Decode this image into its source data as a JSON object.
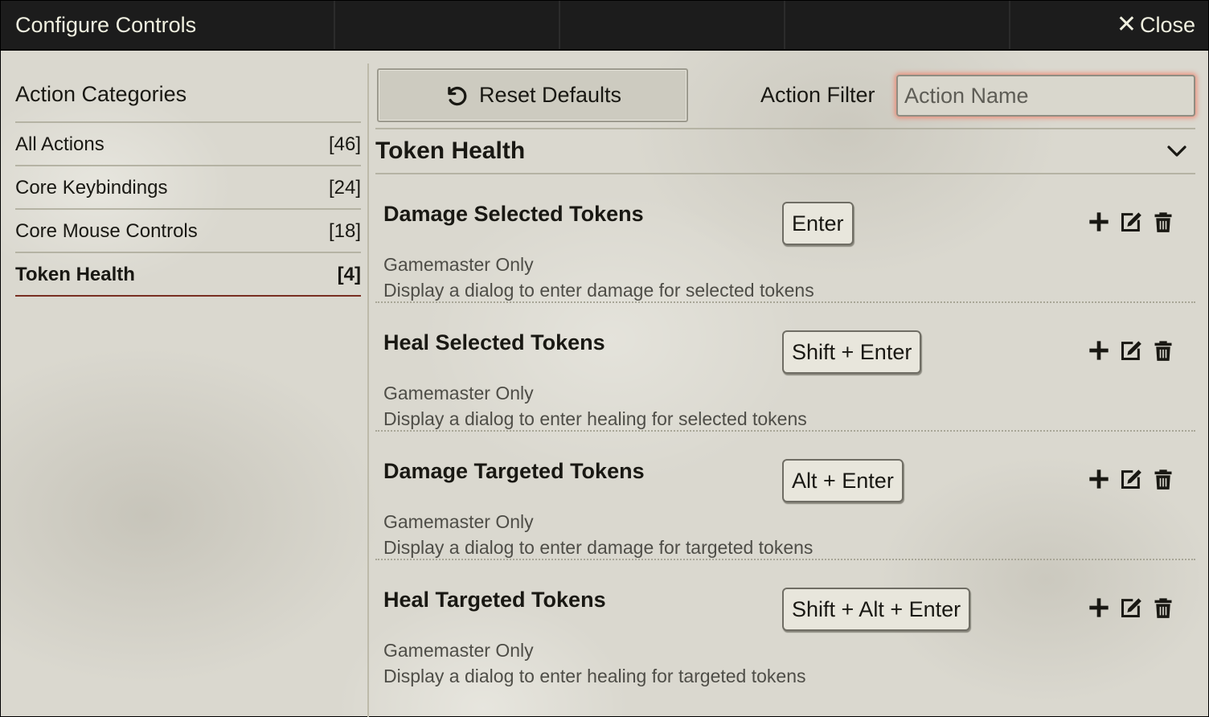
{
  "window": {
    "title": "Configure Controls",
    "close_label": "Close"
  },
  "sidebar": {
    "heading": "Action Categories",
    "categories": [
      {
        "label": "All Actions",
        "count": "[46]"
      },
      {
        "label": "Core Keybindings",
        "count": "[24]"
      },
      {
        "label": "Core Mouse Controls",
        "count": "[18]"
      },
      {
        "label": "Token Health",
        "count": "[4]"
      }
    ]
  },
  "toolbar": {
    "reset_label": "Reset Defaults",
    "filter_label": "Action Filter",
    "filter_placeholder": "Action Name",
    "filter_value": ""
  },
  "section": {
    "title": "Token Health"
  },
  "actions": [
    {
      "name": "Damage Selected Tokens",
      "binding": "Enter",
      "restriction": "Gamemaster Only",
      "description": "Display a dialog to enter damage for selected tokens"
    },
    {
      "name": "Heal Selected Tokens",
      "binding": "Shift + Enter",
      "restriction": "Gamemaster Only",
      "description": "Display a dialog to enter healing for selected tokens"
    },
    {
      "name": "Damage Targeted Tokens",
      "binding": "Alt + Enter",
      "restriction": "Gamemaster Only",
      "description": "Display a dialog to enter damage for targeted tokens"
    },
    {
      "name": "Heal Targeted Tokens",
      "binding": "Shift + Alt + Enter",
      "restriction": "Gamemaster Only",
      "description": "Display a dialog to enter healing for targeted tokens"
    }
  ],
  "icons": {
    "close": "close-icon",
    "reset": "undo-icon",
    "collapse": "chevron-down-icon",
    "add": "plus-icon",
    "edit": "edit-icon",
    "delete": "trash-icon"
  },
  "colors": {
    "titlebar": "#1c1c1c",
    "active_underline": "#782e22",
    "filter_glow": "#ff5a3c",
    "parchment": "#dad8cf"
  }
}
